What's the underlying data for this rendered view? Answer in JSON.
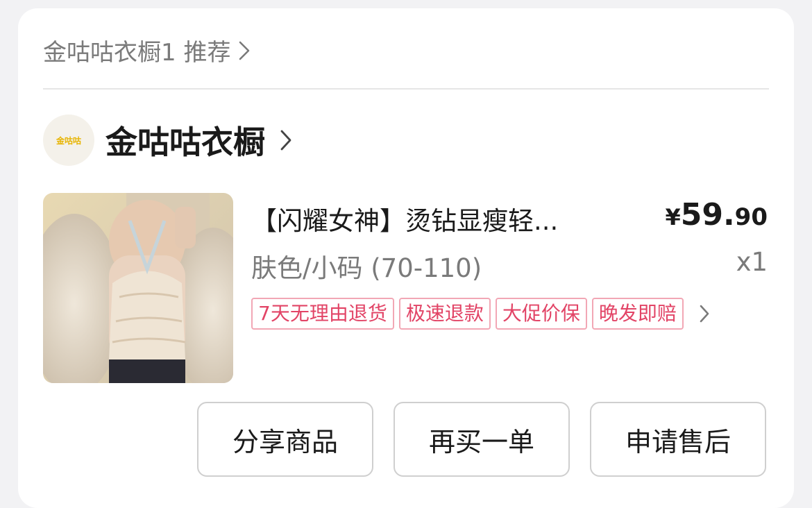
{
  "recommend": {
    "label": "金咕咕衣橱1 推荐"
  },
  "shop": {
    "logo_text": "金咕咕",
    "name": "金咕咕衣橱"
  },
  "product": {
    "title": "【闪耀女神】烫钻显瘦轻...",
    "price_symbol": "¥",
    "price_int": "59.",
    "price_dec": "90",
    "spec": "肤色/小码 (70-110)",
    "quantity": "x1",
    "tags": [
      "7天无理由退货",
      "极速退款",
      "大促价保",
      "晚发即赔"
    ]
  },
  "actions": {
    "share": "分享商品",
    "rebuy": "再买一单",
    "aftersale": "申请售后"
  },
  "colors": {
    "accent": "#e24466",
    "tag_border": "#f2a7b5",
    "logo": "#e7b400"
  }
}
